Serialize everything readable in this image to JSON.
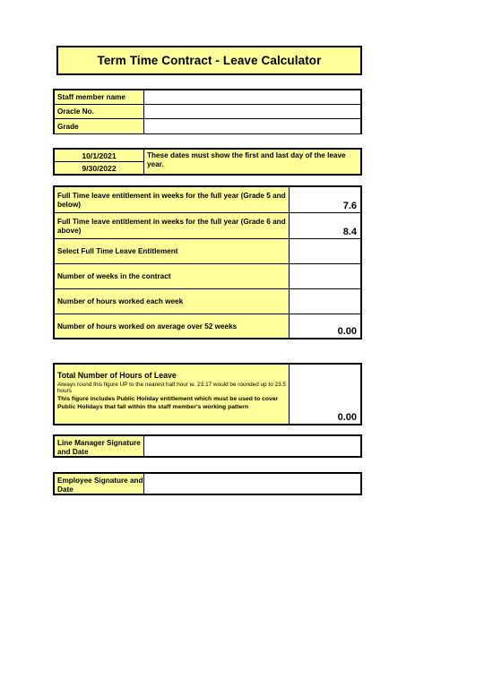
{
  "title": {
    "text": "Term Time Contract - Leave Calculator"
  },
  "staff_details": {
    "rows": [
      {
        "label": "Staff member name",
        "value": ""
      },
      {
        "label": "Oracle No.",
        "value": ""
      },
      {
        "label": "Grade",
        "value": ""
      }
    ]
  },
  "dates": {
    "start_date": "10/1/2021",
    "end_date": "9/30/2022",
    "note": "These dates must show the first and last day of the leave year."
  },
  "entitlement": {
    "rows": [
      {
        "label": "Full Time leave entitlement in weeks for the full year (Grade 5 and below)",
        "value": "7.6"
      },
      {
        "label": "Full Time leave entitlement in weeks for the full year (Grade 6 and above)",
        "value": "8.4"
      },
      {
        "label": "Select Full Time Leave Entitlement",
        "value": ""
      },
      {
        "label": "Number of weeks in the contract",
        "value": ""
      },
      {
        "label": "Number of hours worked each week",
        "value": ""
      },
      {
        "label": "Number of hours worked on average over 52 weeks",
        "value": "0.00"
      }
    ]
  },
  "total": {
    "heading": "Total Number of Hours of Leave",
    "note_rounding": "Always round this figure UP to the nearest half hour ie. 23.17 would be rounded up to 23.5 hours",
    "note_public_holiday": "This figure includes Public Holiday entitlement which must be used to cover Public Holidays that fall within the staff member's working pattern",
    "value": "0.00"
  },
  "signatures": {
    "manager_label": "Line Manager Signature and Date",
    "manager_value": "",
    "employee_label": "Employee Signature and Date",
    "employee_value": ""
  },
  "colors": {
    "highlight": "#ffff99",
    "border": "#000000",
    "background": "#ffffff"
  }
}
